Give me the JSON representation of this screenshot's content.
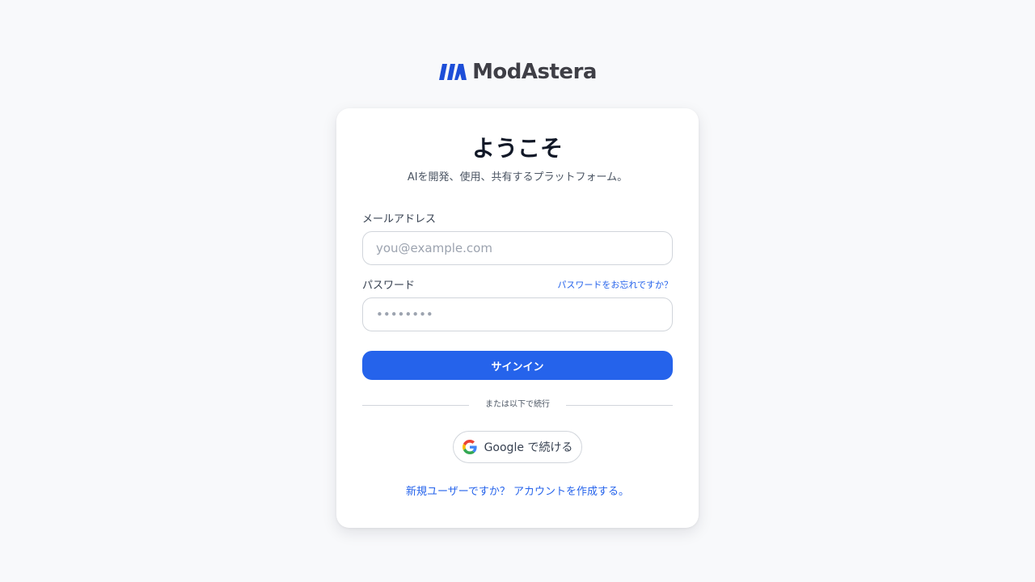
{
  "brand": {
    "name": "ModAstera",
    "logo_icon": "modastera-logo-icon",
    "accent_color": "#2563eb"
  },
  "login": {
    "title": "ようこそ",
    "subtitle": "AIを開発、使用、共有するプラットフォーム。",
    "email": {
      "label": "メールアドレス",
      "placeholder": "you@example.com",
      "value": ""
    },
    "password": {
      "label": "パスワード",
      "placeholder": "••••••••",
      "value": "",
      "forgot_link": "パスワードをお忘れですか？"
    },
    "signin_button": "サインイン",
    "divider_text": "または以下で続行",
    "google_button": {
      "label": "Google で続ける",
      "icon": "google-icon"
    },
    "signup_link": "新規ユーザーですか？ アカウントを作成する。"
  }
}
